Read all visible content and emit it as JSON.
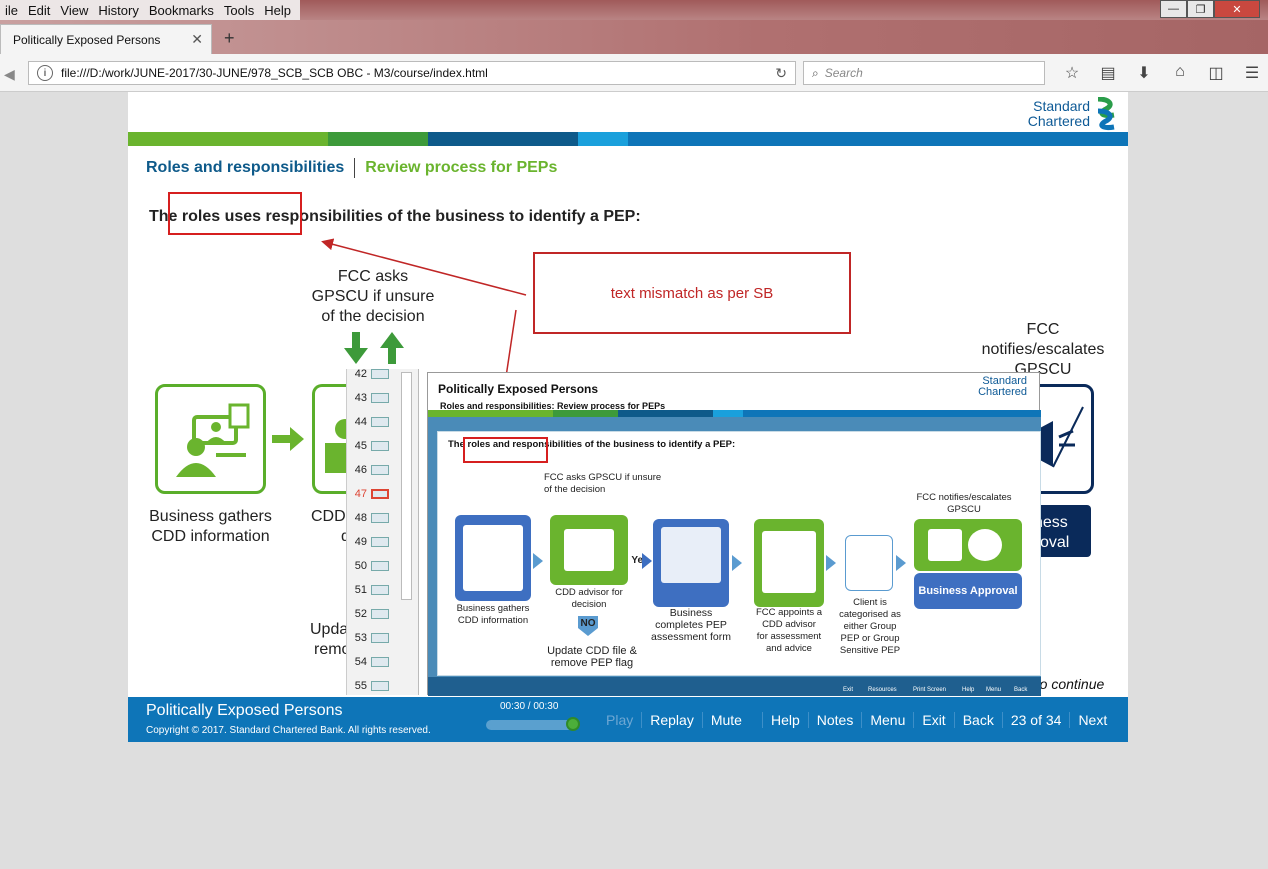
{
  "browser": {
    "menu": [
      "ile",
      "Edit",
      "View",
      "History",
      "Bookmarks",
      "Tools",
      "Help"
    ],
    "tab_title": "Politically Exposed Persons",
    "url": "file:///D:/work/JUNE-2017/30-JUNE/978_SCB_SCB OBC - M3/course/index.html",
    "search_placeholder": "Search"
  },
  "course": {
    "logo_line1": "Standard",
    "logo_line2": "Chartered",
    "nav_active": "Roles and responsibilities",
    "nav_next": "Review process for PEPs",
    "heading": "The roles uses responsibilities of the business to identify a PEP:",
    "fcc_asks": "FCC asks GPSCU if unsure of the decision",
    "fcc_notifies": "FCC notifies/escalates GPSCU",
    "biz_gathers": "Business gathers CDD information",
    "cdd_partial_1": "CDD",
    "cdd_partial_2": "d",
    "update_partial_1": "Upda",
    "update_partial_2": "remo",
    "approval_partial_1": "ness",
    "approval_partial_2": "oval",
    "continue_text": "t to continue",
    "annotation": "text mismatch as per SB",
    "colors": {
      "green": "#6ab42e",
      "dark_green": "#3d9a3a",
      "blue": "#0e75b8",
      "navy": "#0a2a5a",
      "annotation_red": "#c02626"
    }
  },
  "footer": {
    "title": "Politically Exposed Persons",
    "copyright": "Copyright © 2017. Standard Chartered Bank. All rights reserved.",
    "time": "00:30 / 00:30",
    "progress": 1.0,
    "buttons": {
      "play": "Play",
      "replay": "Replay",
      "mute": "Mute",
      "help": "Help",
      "notes": "Notes",
      "menu": "Menu",
      "exit": "Exit",
      "back": "Back",
      "page": "23 of 34",
      "next": "Next"
    }
  },
  "thumbnails": [
    "42",
    "43",
    "44",
    "45",
    "46",
    "47",
    "48",
    "49",
    "50",
    "51",
    "52",
    "53",
    "54",
    "55"
  ],
  "selected_thumbnail": "47",
  "reference_shot": {
    "title": "Politically Exposed Persons",
    "subtitle": "Roles and responsibilities: Review process for PEPs",
    "logo_line1": "Standard",
    "logo_line2": "Chartered",
    "heading": "The roles and responsibilities of the business to identify a PEP:",
    "fcc_asks": "FCC asks GPSCU if unsure of the decision",
    "fcc_notifies": "FCC notifies/escalates GPSCU",
    "step1": "Business gathers CDD information",
    "step2": "CDD advisor for decision",
    "yes": "Yes",
    "no": "NO",
    "update": "Update CDD file & remove PEP flag",
    "step3": "Business completes PEP assessment form",
    "step4": "FCC appoints a CDD advisor for assessment and advice",
    "step5": "Client is categorised as either Group PEP or Group Sensitive PEP",
    "approval": "Business Approval",
    "footer_links": [
      "Exit",
      "Resources",
      "Print Screen",
      "Help",
      "Menu",
      "Back"
    ]
  }
}
